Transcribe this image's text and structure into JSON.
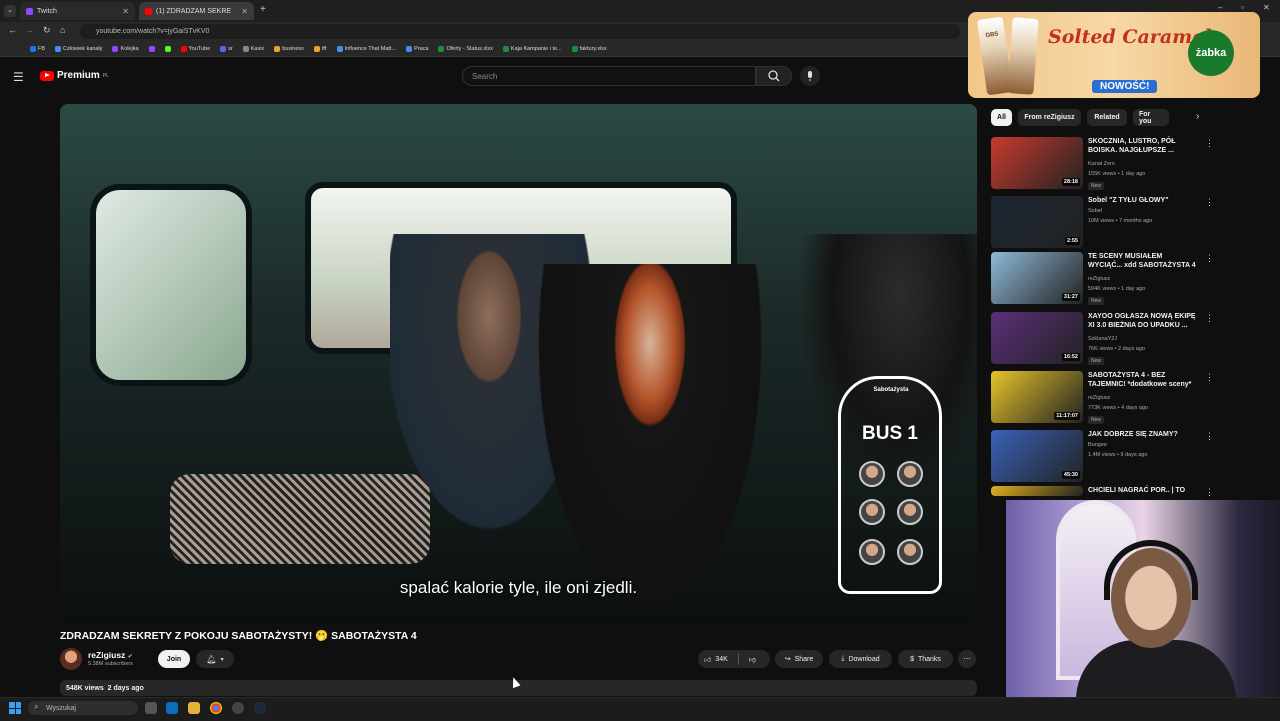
{
  "browser": {
    "tabs": [
      {
        "label": "Twitch",
        "active": false
      },
      {
        "label": "(1) ZDRADZAM SEKRETY Z",
        "active": true
      }
    ],
    "url": "youtube.com/watch?v=jyGaiSTvKV0",
    "bookmarks": [
      "FB",
      "Człowiek kanały",
      "Kolejka",
      "",
      "",
      "YouTube",
      "sr",
      "Kasix",
      "business",
      "tft",
      "Influence That Matt...",
      "Praca",
      "Oferty - Status.xlsx",
      "Kaja Kampanie i te...",
      "faktury.xlsx"
    ]
  },
  "header": {
    "logo_text": "Premium",
    "logo_region": "PL",
    "search_placeholder": "Search"
  },
  "player": {
    "subtitle": "spalać kalorie tyle, ile oni zjedli.",
    "overlay_logo": "Sabotażysta",
    "overlay_title": "BUS 1"
  },
  "video": {
    "title": "ZDRADZAM SEKRETY Z POKOJU SABOTAŻYSTY! 🫢 SABOTAŻYSTA 4",
    "channel": "reZigiusz",
    "subscribers": "5.38M subscribers",
    "join_label": "Join",
    "likes": "34K",
    "share_label": "Share",
    "download_label": "Download",
    "thanks_label": "Thanks",
    "views_date": "548K views  2 days ago"
  },
  "sidebar": {
    "chips": [
      "All",
      "From reZigiusz",
      "Related",
      "For you"
    ],
    "items": [
      {
        "title": "SKOCZNIA, LUSTRO, PÓŁ BOISKA. NAJGŁUPSZE ...",
        "channel": "Kanał Zero",
        "meta": "155K views • 1 day ago",
        "badge": "New",
        "duration": "28:18",
        "thumb_color": "#c93a2d"
      },
      {
        "title": "Sobel \"Z TYŁU GŁOWY\"",
        "channel": "Sobel",
        "meta": "10M views • 7 months ago",
        "badge": "",
        "duration": "2:55",
        "thumb_color": "#1c2633"
      },
      {
        "title": "TE SCENY MUSIAŁEM WYCIĄĆ... xdd SABOTAŻYSTA 4",
        "channel": "reZigiusz",
        "meta": "594K views • 1 day ago",
        "badge": "New",
        "duration": "31:27",
        "thumb_color": "#8eb9d8"
      },
      {
        "title": "XAYOO OGŁASZA NOWĄ EKIPĘ XI 3.0 BIEŻNIA DO UPADKU ...",
        "channel": "SzklanaY2J",
        "meta": "76K views • 2 days ago",
        "badge": "New",
        "duration": "16:52",
        "thumb_color": "#5b2f7a"
      },
      {
        "title": "SABOTAŻYSTA 4 - BEZ TAJEMNIC! *dodatkowe sceny*",
        "channel": "reZigiusz",
        "meta": "773K views • 4 days ago",
        "badge": "New",
        "duration": "11:17:07",
        "thumb_color": "#e6c42a"
      },
      {
        "title": "JAK DOBRZE SIĘ ZNAMY?",
        "channel": "Bungee",
        "meta": "1.4M views • 9 days ago",
        "badge": "",
        "duration": "45:30",
        "thumb_color": "#3a62b8"
      },
      {
        "title": "CHCIELI NAGRAĆ POR.. | TO",
        "channel": "",
        "meta": "",
        "badge": "",
        "duration": "",
        "thumb_color": "#e0b020"
      }
    ]
  },
  "ad": {
    "headline": "Solted Caramel",
    "badge": "NOWOŚĆ!",
    "brand": "żabka",
    "product_label": "GBS"
  },
  "taskbar": {
    "search_placeholder": "Wyszukaj"
  }
}
